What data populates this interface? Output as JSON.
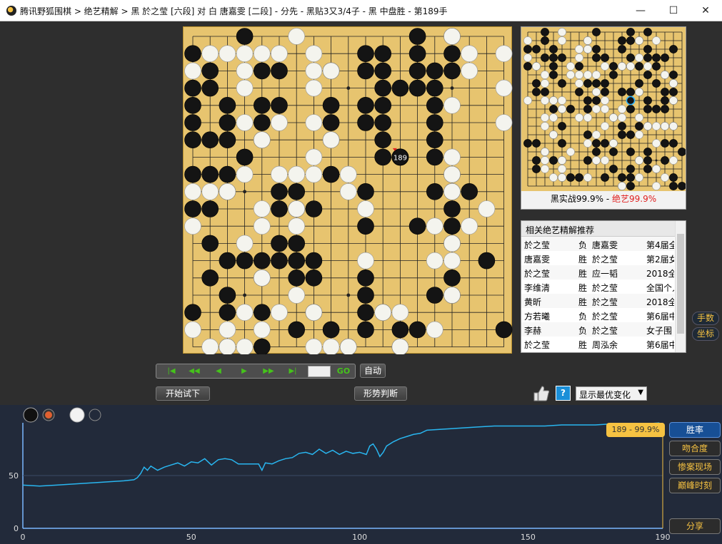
{
  "window": {
    "title": "腾讯野狐围棋 > 绝艺精解 > 黑 於之莹 [六段] 对 白 唐嘉雯 [二段] - 分先 - 黑贴3又3/4子 - 黑 中盘胜 - 第189手",
    "minimize": "—",
    "maximize": "☐",
    "close": "✕"
  },
  "board": {
    "size": 19,
    "last_move_label": "189",
    "black_rows": [
      "...B.........B.B...",
      "B.........BB.B.B...",
      ".B..BB..B.BB.BBB...",
      "BB.........BBBB....",
      "B.B.BB..B.BB..B....",
      "B.B.B...B.BB..B....",
      "BBB.B...B..B..B....",
      "...B.......B..B....",
      "BBB.....B......B...",
      "..B..BB...B...BBB..",
      "BB...BBB.......B...",
      "..........B..B.B...",
      ".B...BB........B...",
      "..BBBBBB.........B.",
      ".B..B.BB..B....B...",
      "..B.......B...BB...",
      "B.B.B..B..BB.......",
      "......B.B.B.BB....B",
      "..B.B....B..B......"
    ],
    "white_rows": [
      "......W........W...",
      ".WWWWW.W........W.W",
      "W..W...WW.......W..",
      "...W...W..........W",
      "...............W...",
      "...W.W.W..........W",
      "....W...W..........",
      ".......W.......W...",
      "...W.WWW.W.....W...",
      "WWW......W.....W...",
      "....W.W...W......W.",
      "W...W.W.......W.W..",
      "...W...........W...",
      "..........W...WW...",
      "....W..............",
      "......W........W...",
      "...W.W.W...WW......",
      "W.W.W.........W....",
      ".WWW...WWW..W......"
    ]
  },
  "miniboard": {
    "caption_black": "黑实战99.9%",
    "caption_sep": " - ",
    "caption_ai": "绝艺99.9%",
    "marker": {
      "x": 12,
      "y": 8
    },
    "black_rows": [
      "..B.....B...B.B....",
      "..B....B...BBB.....",
      "BB.B...BB..B..B..B.",
      "..BBB...BB..B.BBB..",
      "BB.B..B...BBBB.B...",
      "...B......B...B.BB.",
      ".B..B..BBB...B.B.B.",
      ".BB...B.BB.BBB..BB.",
      "...B...BB...B.B.BB.",
      "...BBB.B....B.BBB..",
      "..........B........",
      "....B......B.BB.BB.",
      "...B...B...BB......",
      "BB..B...BBB.....BB.",
      "..B.....B.B.B.B...B",
      ".B.BB..BB....BB.B..",
      ".B........B.B.BB...",
      "....BBB..B.BB....B.",
      "...........BB....BB"
    ],
    "white_rows": [
      "....W..............",
      "W...W..W.....W.W...",
      "......WW...........",
      "W.....W......W.....",
      ".W...W...W.WW.W....",
      "..W..WWWW.......W..",
      "..W...W..........W.",
      "........W....W.....",
      "W.WWW....W.......W.",
      "....W...WW.W.......",
      "..WW..WW..WW.W.....",
      "..W......W....WWWW.",
      "...W....W....W.....",
      ".......W..W....W...",
      "..W..W.............",
      "..W.W...WW...W...W.",
      "..W.W..........W...",
      "...WW..W.....W..W..",
      "...........W...W..."
    ]
  },
  "recommend": {
    "header": "相关绝艺精解推荐",
    "rows": [
      {
        "p1": "於之莹",
        "res": "负",
        "p2": "唐嘉雯",
        "event": "第4届全"
      },
      {
        "p1": "唐嘉雯",
        "res": "胜",
        "p2": "於之莹",
        "event": "第2届女"
      },
      {
        "p1": "於之莹",
        "res": "胜",
        "p2": "应一韬",
        "event": "2018全国"
      },
      {
        "p1": "李维清",
        "res": "胜",
        "p2": "於之莹",
        "event": "全国个人"
      },
      {
        "p1": "黄昕",
        "res": "胜",
        "p2": "於之莹",
        "event": "2018全国"
      },
      {
        "p1": "方若曦",
        "res": "负",
        "p2": "於之莹",
        "event": "第6届中"
      },
      {
        "p1": "李赫",
        "res": "负",
        "p2": "於之莹",
        "event": "女子围"
      },
      {
        "p1": "於之莹",
        "res": "胜",
        "p2": "周泓余",
        "event": "第6届中"
      }
    ]
  },
  "side_buttons": {
    "moves": "手数",
    "coords": "坐标"
  },
  "controls": {
    "first": "|◀",
    "prev10": "◀◀",
    "prev": "◀",
    "next": "▶",
    "next10": "▶▶",
    "last": "▶|",
    "move_value": "",
    "go": "GO",
    "auto": "自动",
    "try": "开始试下",
    "judge": "形势判断",
    "select": "显示最优变化",
    "help": "?"
  },
  "chart_panel": {
    "buttons": [
      "胜率",
      "吻合度",
      "惨案现场",
      "巅峰时刻"
    ],
    "share": "分享",
    "tooltip": "189 - 99.9%",
    "colors": {
      "line": "#29b6f0",
      "accent": "#f6c242",
      "active": "#174f95"
    }
  },
  "chart_data": {
    "type": "line",
    "xlim": [
      0,
      190
    ],
    "ylim": [
      0,
      100
    ],
    "xticks": [
      0,
      50,
      100,
      150,
      190
    ],
    "yticks": [
      0,
      50
    ],
    "series": [
      {
        "points": [
          [
            0,
            41
          ],
          [
            5,
            40
          ],
          [
            10,
            41
          ],
          [
            15,
            42
          ],
          [
            20,
            43
          ],
          [
            25,
            44
          ],
          [
            30,
            45
          ],
          [
            33,
            46
          ],
          [
            34,
            48
          ],
          [
            35,
            52
          ],
          [
            36,
            58
          ],
          [
            37,
            55
          ],
          [
            38,
            59
          ],
          [
            40,
            55
          ],
          [
            42,
            58
          ],
          [
            44,
            60
          ],
          [
            46,
            62
          ],
          [
            48,
            59
          ],
          [
            50,
            63
          ],
          [
            52,
            62
          ],
          [
            54,
            66
          ],
          [
            56,
            60
          ],
          [
            58,
            65
          ],
          [
            60,
            66
          ],
          [
            62,
            65
          ],
          [
            64,
            61
          ],
          [
            66,
            61
          ],
          [
            68,
            61
          ],
          [
            70,
            61
          ],
          [
            71,
            55
          ],
          [
            72,
            62
          ],
          [
            74,
            61
          ],
          [
            76,
            64
          ],
          [
            78,
            66
          ],
          [
            80,
            67
          ],
          [
            82,
            71
          ],
          [
            84,
            72
          ],
          [
            86,
            70
          ],
          [
            88,
            75
          ],
          [
            90,
            71
          ],
          [
            92,
            74
          ],
          [
            94,
            70
          ],
          [
            96,
            73
          ],
          [
            98,
            71
          ],
          [
            100,
            72
          ],
          [
            102,
            70
          ],
          [
            103,
            78
          ],
          [
            104,
            80
          ],
          [
            105,
            75
          ],
          [
            106,
            68
          ],
          [
            107,
            72
          ],
          [
            108,
            78
          ],
          [
            110,
            82
          ],
          [
            112,
            85
          ],
          [
            114,
            87
          ],
          [
            116,
            89
          ],
          [
            118,
            90
          ],
          [
            120,
            93
          ],
          [
            125,
            94
          ],
          [
            130,
            95
          ],
          [
            135,
            96
          ],
          [
            140,
            97
          ],
          [
            145,
            97
          ],
          [
            150,
            97
          ],
          [
            155,
            97
          ],
          [
            160,
            98
          ],
          [
            165,
            98
          ],
          [
            170,
            98
          ],
          [
            175,
            99
          ],
          [
            180,
            99
          ],
          [
            185,
            99
          ],
          [
            189,
            99.9
          ]
        ]
      }
    ]
  }
}
